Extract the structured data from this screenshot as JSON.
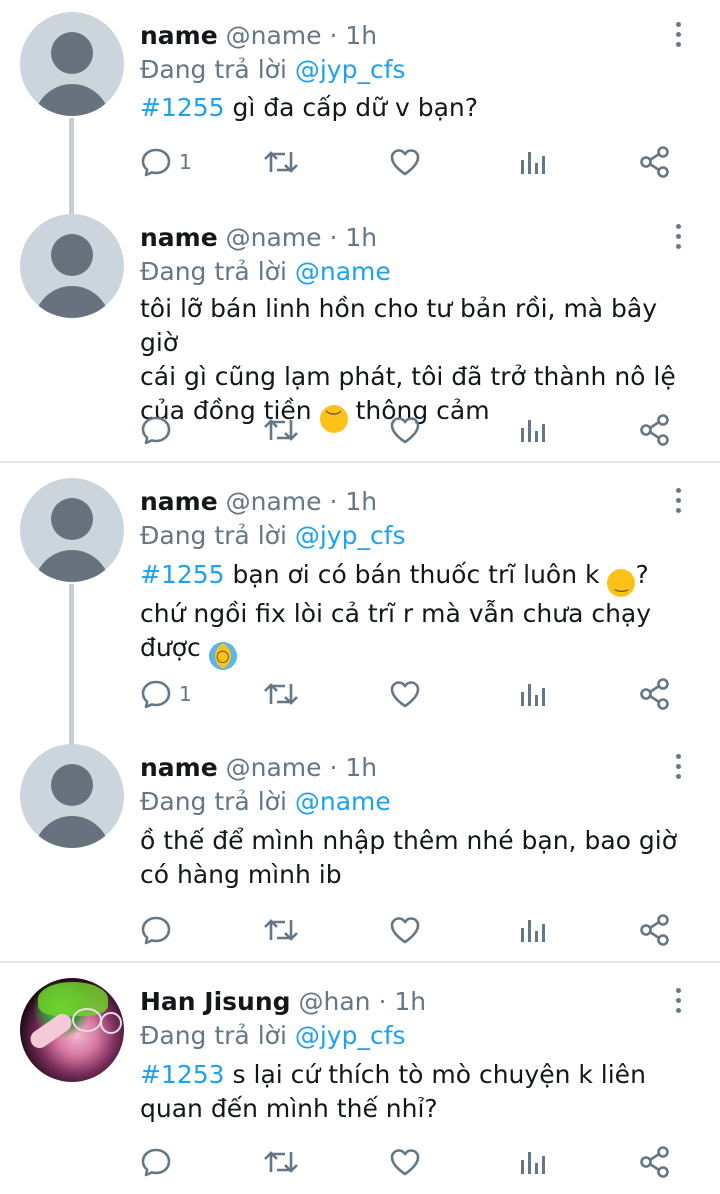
{
  "tweets": [
    {
      "name": "name",
      "handle": "@name",
      "time": "1h",
      "reply_prefix": "Đang trả lời",
      "reply_to": "@jyp_cfs",
      "hashtag": "#1255",
      "text": "gì đa cấp dữ v bạn?",
      "reply_count": "1",
      "avatar": "default-avatar"
    },
    {
      "name": "name",
      "handle": "@name",
      "time": "1h",
      "reply_prefix": "Đang trả lời",
      "reply_to": "@name",
      "line1": "tôi lỡ bán linh hồn cho tư bản rồi, mà bây giờ",
      "line2": "cái gì cũng lạm phát, tôi đã trở thành nô lệ",
      "line3a": "của đồng tiền",
      "emoji": "disappointed-face",
      "line3b": "thông cảm",
      "avatar": "default-avatar"
    },
    {
      "name": "name",
      "handle": "@name",
      "time": "1h",
      "reply_prefix": "Đang trả lời",
      "reply_to": "@jyp_cfs",
      "hashtag": "#1255",
      "line1": "bạn ơi có bán thuốc trĩ luôn k",
      "emoji1": "slightly-smiling-face",
      "line1_end": "?",
      "line2": "chứ ngồi fix lòi cả trĩ r mà vẫn chưa chạy",
      "line3": "được",
      "emoji2": "loudly-crying-face",
      "reply_count": "1",
      "avatar": "default-avatar"
    },
    {
      "name": "name",
      "handle": "@name",
      "time": "1h",
      "reply_prefix": "Đang trả lời",
      "reply_to": "@name",
      "line1": "ồ thế để mình nhập thêm nhé bạn, bao giờ",
      "line2": "có hàng mình ib",
      "avatar": "default-avatar"
    },
    {
      "name": "Han Jisung",
      "handle": "@han",
      "time": "1h",
      "reply_prefix": "Đang trả lời",
      "reply_to": "@jyp_cfs",
      "hashtag": "#1253",
      "line1": "s lại cứ thích tò mò chuyện k liên",
      "line2": "quan đến mình thế nhỉ?",
      "avatar": "profile-photo"
    }
  ],
  "separator": "·",
  "icons": [
    "reply-icon",
    "retweet-icon",
    "like-icon",
    "analytics-icon",
    "share-icon",
    "more-icon"
  ],
  "colors": {
    "link": "#1da1f2",
    "muted": "#657786",
    "text": "#14171a",
    "divider": "#e3e7ea",
    "avatar_bg": "#cdd5dc"
  }
}
